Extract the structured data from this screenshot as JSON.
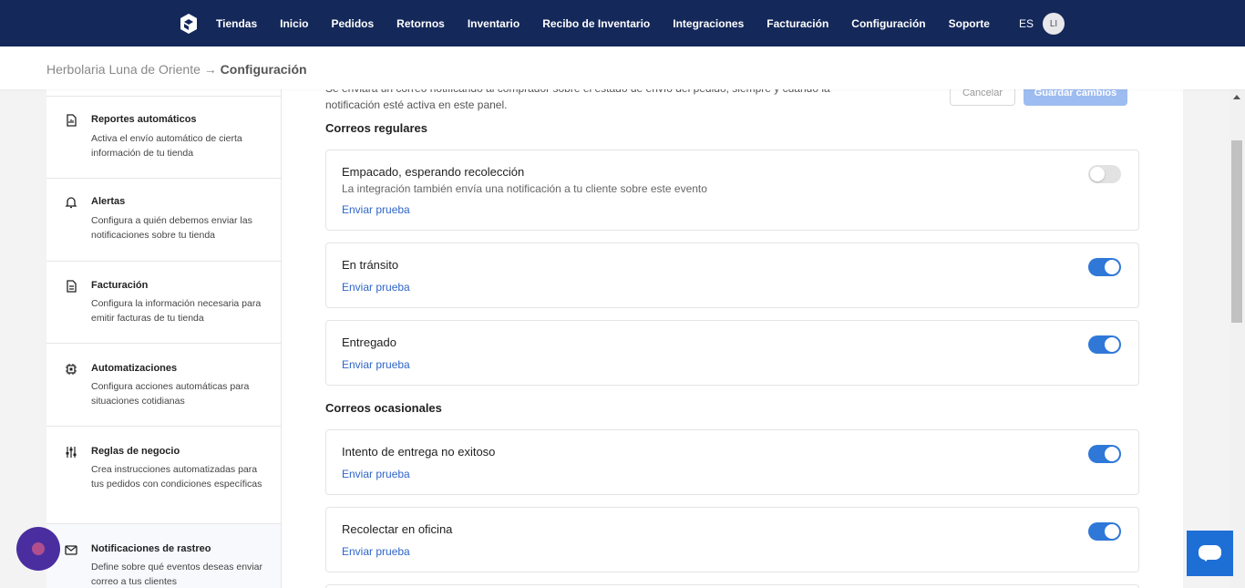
{
  "nav": {
    "links": [
      "Tiendas",
      "Inicio",
      "Pedidos",
      "Retornos",
      "Inventario",
      "Recibo de Inventario",
      "Integraciones",
      "Facturación",
      "Configuración",
      "Soporte"
    ],
    "lang": "ES",
    "avatar_initials": "LI"
  },
  "breadcrumb": {
    "store": "Herbolaria Luna de Oriente",
    "separator": " → ",
    "current": "Configuración"
  },
  "sidebar": {
    "items": [
      {
        "title": "Reportes automáticos",
        "desc": "Activa el envío automático de cierta información de tu tienda",
        "icon": "report-icon"
      },
      {
        "title": "Alertas",
        "desc": "Configura a quién debemos enviar las notificaciones sobre tu tienda",
        "icon": "bell-icon"
      },
      {
        "title": "Facturación",
        "desc": "Configura la información necesaria para emitir facturas de tu tienda",
        "icon": "document-icon"
      },
      {
        "title": "Automatizaciones",
        "desc": "Configura acciones automáticas para situaciones cotidianas",
        "icon": "chip-icon"
      },
      {
        "title": "Reglas de negocio",
        "desc": "Crea instrucciones automatizadas para tus pedidos con condiciones específicas",
        "icon": "sliders-icon"
      },
      {
        "title": "Notificaciones de rastreo",
        "desc": "Define sobre qué eventos deseas enviar correo a tus clientes",
        "icon": "mail-icon"
      }
    ]
  },
  "main": {
    "intro": "Se enviará un correo notificando al comprador sobre el estado de envío del pedido, siempre y cuando la notificación esté activa en este panel.",
    "cancel_label": "Cancelar",
    "save_label": "Guardar cambios",
    "section_regular": "Correos regulares",
    "section_occasional": "Correos ocasionales",
    "test_link": "Enviar prueba",
    "cards": [
      {
        "title": "Empacado, esperando recolección",
        "desc": "La integración también envía una notificación a tu cliente sobre este evento",
        "enabled": false
      },
      {
        "title": "En tránsito",
        "enabled": true
      },
      {
        "title": "Entregado",
        "enabled": true
      },
      {
        "title": "Intento de entrega no exitoso",
        "enabled": true
      },
      {
        "title": "Recolectar en oficina",
        "enabled": true
      }
    ]
  },
  "colors": {
    "nav_bg": "#14285a",
    "accent": "#2f78d8",
    "link": "#2f66c8",
    "save_disabled": "#9dbcf0"
  }
}
